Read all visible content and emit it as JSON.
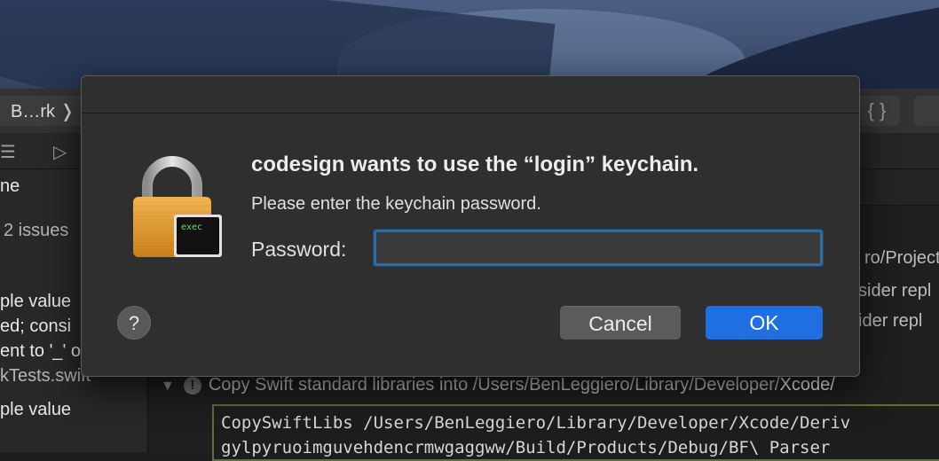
{
  "xcode": {
    "scheme_label": "B…rk ❭",
    "braces_label": "{ }",
    "navigator": {
      "lines": [
        {
          "text": "ne",
          "dim": false
        },
        {
          "text": "2 issues",
          "dim": true
        },
        {
          "text": "ple value",
          "dim": false
        },
        {
          "text": "ed; consi",
          "dim": false
        },
        {
          "text": "ent to '_' or…",
          "dim": false
        },
        {
          "text": "kTests.swift",
          "dim": true
        },
        {
          "text": "ple value",
          "dim": false
        }
      ]
    },
    "log_fragments": [
      "ro/Project",
      "sider repl",
      "ider repl"
    ],
    "build_step": {
      "prefix": "Copy Swift standard libraries into /Users/BenLeggiero/Library/Developer/",
      "highlight": "Xcode/"
    },
    "console_lines": [
      "CopySwiftLibs /Users/BenLeggiero/Library/Developer/Xcode/Deriv",
      "  gylpyruoimguvehdencrmwgaggww/Build/Products/Debug/BF\\ Parser"
    ]
  },
  "dialog": {
    "icon": "lock-exec-icon",
    "badge_text": "exec",
    "title": "codesign wants to use the “login” keychain.",
    "message": "Please enter the keychain password.",
    "password_label": "Password:",
    "password_value": "",
    "help_label": "?",
    "cancel_label": "Cancel",
    "ok_label": "OK",
    "accent_color": "#1f6fe0"
  }
}
